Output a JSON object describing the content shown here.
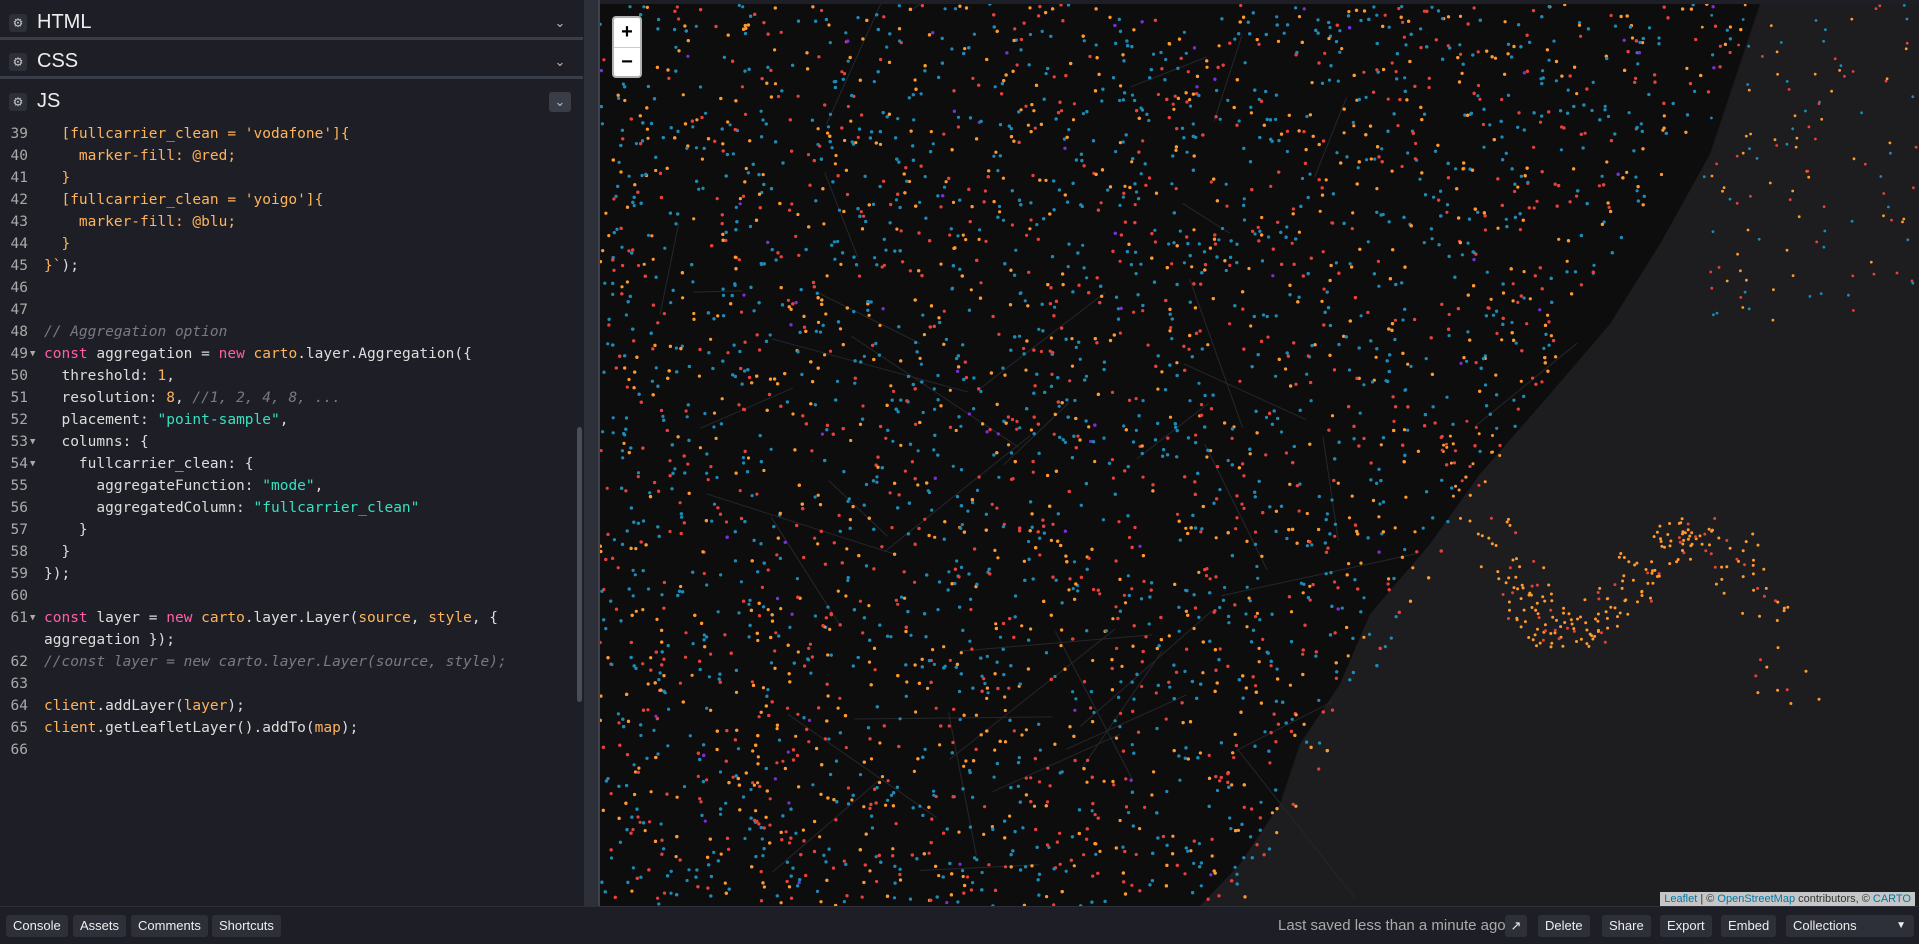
{
  "panels": [
    {
      "title": "HTML",
      "icon": "gear-icon"
    },
    {
      "title": "CSS",
      "icon": "gear-icon"
    },
    {
      "title": "JS",
      "icon": "gear-icon"
    }
  ],
  "code_lines": [
    {
      "n": "39",
      "fold": false,
      "t": [
        [
          "p",
          "  "
        ],
        [
          "o",
          "[fullcarrier_clean = 'vodafone']{"
        ]
      ]
    },
    {
      "n": "40",
      "fold": false,
      "t": [
        [
          "o",
          "    marker-fill: @red;"
        ]
      ]
    },
    {
      "n": "41",
      "fold": false,
      "t": [
        [
          "o",
          "  }"
        ]
      ]
    },
    {
      "n": "42",
      "fold": false,
      "t": [
        [
          "o",
          "  [fullcarrier_clean = 'yoigo']{"
        ]
      ]
    },
    {
      "n": "43",
      "fold": false,
      "t": [
        [
          "o",
          "    marker-fill: @blu;"
        ]
      ]
    },
    {
      "n": "44",
      "fold": false,
      "t": [
        [
          "o",
          "  }"
        ]
      ]
    },
    {
      "n": "45",
      "fold": false,
      "t": [
        [
          "o",
          "}`"
        ],
        [
          "p",
          ");"
        ]
      ]
    },
    {
      "n": "46",
      "fold": false,
      "t": [
        [
          "p",
          ""
        ]
      ]
    },
    {
      "n": "47",
      "fold": false,
      "t": [
        [
          "p",
          ""
        ]
      ]
    },
    {
      "n": "48",
      "fold": false,
      "t": [
        [
          "c",
          "// Aggregation option"
        ]
      ]
    },
    {
      "n": "49",
      "fold": true,
      "t": [
        [
          "k",
          "const"
        ],
        [
          "p",
          " aggregation = "
        ],
        [
          "k",
          "new"
        ],
        [
          "p",
          " "
        ],
        [
          "o",
          "carto"
        ],
        [
          "p",
          ".layer.Aggregation({"
        ]
      ]
    },
    {
      "n": "50",
      "fold": false,
      "t": [
        [
          "p",
          "  threshold: "
        ],
        [
          "n",
          "1"
        ],
        [
          "p",
          ","
        ]
      ]
    },
    {
      "n": "51",
      "fold": false,
      "t": [
        [
          "p",
          "  resolution: "
        ],
        [
          "n",
          "8"
        ],
        [
          "p",
          ", "
        ],
        [
          "c",
          "//1, 2, 4, 8, ..."
        ]
      ]
    },
    {
      "n": "52",
      "fold": false,
      "t": [
        [
          "p",
          "  placement: "
        ],
        [
          "s",
          "\"point-sample\""
        ],
        [
          "p",
          ","
        ]
      ]
    },
    {
      "n": "53",
      "fold": true,
      "t": [
        [
          "p",
          "  columns: {"
        ]
      ]
    },
    {
      "n": "54",
      "fold": true,
      "t": [
        [
          "p",
          "    fullcarrier_clean: {"
        ]
      ]
    },
    {
      "n": "55",
      "fold": false,
      "t": [
        [
          "p",
          "      aggregateFunction: "
        ],
        [
          "s",
          "\"mode\""
        ],
        [
          "p",
          ","
        ]
      ]
    },
    {
      "n": "56",
      "fold": false,
      "t": [
        [
          "p",
          "      aggregatedColumn: "
        ],
        [
          "s",
          "\"fullcarrier_clean\""
        ]
      ]
    },
    {
      "n": "57",
      "fold": false,
      "t": [
        [
          "p",
          "    }"
        ]
      ]
    },
    {
      "n": "58",
      "fold": false,
      "t": [
        [
          "p",
          "  }"
        ]
      ]
    },
    {
      "n": "59",
      "fold": false,
      "t": [
        [
          "p",
          "});"
        ]
      ]
    },
    {
      "n": "60",
      "fold": false,
      "t": [
        [
          "p",
          ""
        ]
      ]
    },
    {
      "n": "61",
      "fold": true,
      "t": [
        [
          "k",
          "const"
        ],
        [
          "p",
          " layer = "
        ],
        [
          "k",
          "new"
        ],
        [
          "p",
          " "
        ],
        [
          "o",
          "carto"
        ],
        [
          "p",
          ".layer.Layer("
        ],
        [
          "o",
          "source"
        ],
        [
          "p",
          ", "
        ],
        [
          "o",
          "style"
        ],
        [
          "p",
          ", {"
        ]
      ]
    },
    {
      "n": "",
      "fold": false,
      "t": [
        [
          "p",
          "aggregation });"
        ]
      ]
    },
    {
      "n": "62",
      "fold": false,
      "t": [
        [
          "c",
          "//const layer = new carto.layer.Layer(source, style);"
        ]
      ]
    },
    {
      "n": "63",
      "fold": false,
      "t": [
        [
          "p",
          ""
        ]
      ]
    },
    {
      "n": "64",
      "fold": false,
      "t": [
        [
          "o",
          "client"
        ],
        [
          "p",
          ".addLayer("
        ],
        [
          "o",
          "layer"
        ],
        [
          "p",
          ");"
        ]
      ]
    },
    {
      "n": "65",
      "fold": false,
      "t": [
        [
          "o",
          "client"
        ],
        [
          "p",
          ".getLeafletLayer().addTo("
        ],
        [
          "o",
          "map"
        ],
        [
          "p",
          ");"
        ]
      ]
    },
    {
      "n": "66",
      "fold": false,
      "t": [
        [
          "p",
          ""
        ]
      ]
    }
  ],
  "map": {
    "zoom_in": "+",
    "zoom_out": "−",
    "attribution": {
      "leaflet": "Leaflet",
      "sep": " | © ",
      "osm": "OpenStreetMap",
      "contrib": " contributors, © ",
      "carto": "CARTO"
    },
    "colors": {
      "orange": "#ff9a2e",
      "red": "#e8403c",
      "blue": "#1d8bb6",
      "purple": "#7b2fd6"
    }
  },
  "toolbar": {
    "left": [
      "Console",
      "Assets",
      "Comments",
      "Shortcuts"
    ],
    "saved": "Last saved less than a minute ago",
    "open_icon": "external-link-icon",
    "right": [
      "Delete",
      "Share",
      "Export",
      "Embed"
    ],
    "collections": "Collections"
  }
}
